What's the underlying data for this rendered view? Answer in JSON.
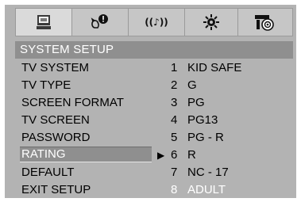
{
  "icons": [
    "tv-icon",
    "language-icon",
    "audio-icon",
    "brightness-icon",
    "speaker-icon"
  ],
  "audio_icon_text": "((♪))",
  "header": "SYSTEM SETUP",
  "menu": [
    "TV SYSTEM",
    "TV TYPE",
    "SCREEN FORMAT",
    "TV SCREEN",
    "PASSWORD",
    "RATING",
    "DEFAULT",
    "EXIT SETUP"
  ],
  "selected_index": 5,
  "arrow": "▶",
  "options": [
    {
      "num": "1",
      "label": "KID SAFE"
    },
    {
      "num": "2",
      "label": "G"
    },
    {
      "num": "3",
      "label": "PG"
    },
    {
      "num": "4",
      "label": "PG13"
    },
    {
      "num": "5",
      "label": "PG - R"
    },
    {
      "num": "6",
      "label": "R"
    },
    {
      "num": "7",
      "label": "NC - 17"
    },
    {
      "num": "8",
      "label": "ADULT"
    }
  ],
  "current_option_index": 7
}
